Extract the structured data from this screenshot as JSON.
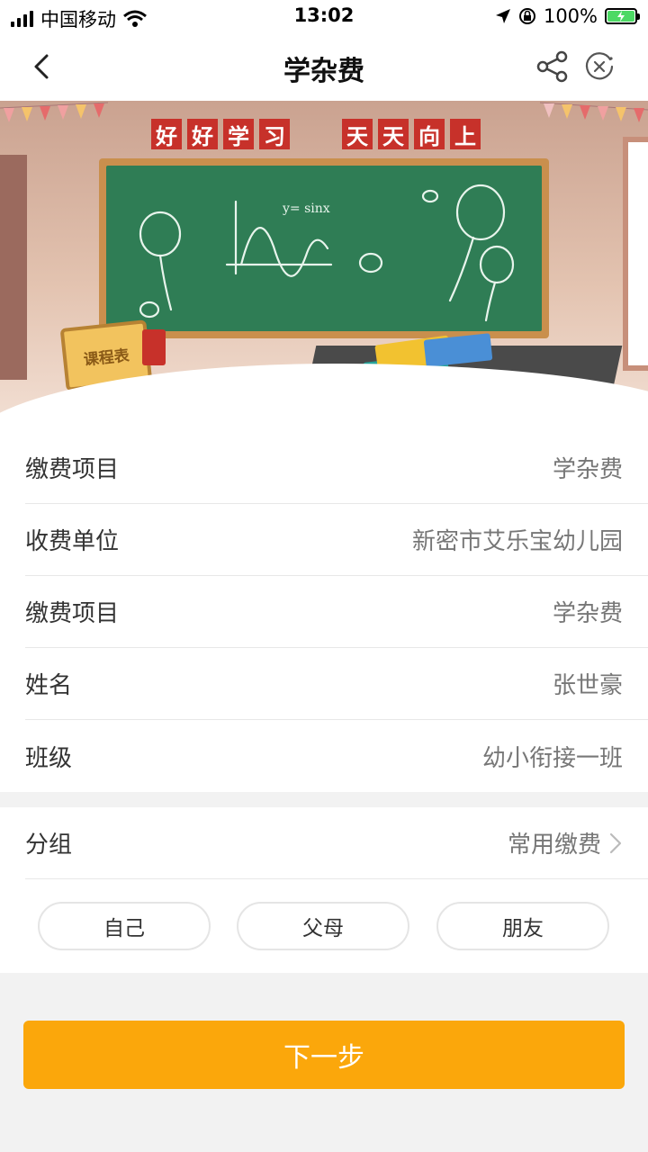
{
  "status_bar": {
    "carrier": "中国移动",
    "time": "13:02",
    "battery": "100%",
    "icons": [
      "signal-icon",
      "wifi-icon",
      "location-icon",
      "orientation-lock-icon",
      "battery-charging-icon"
    ]
  },
  "nav": {
    "title": "学杂费",
    "back_icon": "chevron-left-icon",
    "share_icon": "share-icon",
    "close_icon": "close-circle-icon"
  },
  "banner": {
    "slogan_left": [
      "好",
      "好",
      "学",
      "习"
    ],
    "slogan_right": [
      "天",
      "天",
      "向",
      "上"
    ],
    "board_formula": "y= sinx",
    "timetable_label": "课程表"
  },
  "info_rows": [
    {
      "label": "缴费项目",
      "value": "学杂费"
    },
    {
      "label": "收费单位",
      "value": "新密市艾乐宝幼儿园"
    },
    {
      "label": "缴费项目",
      "value": "学杂费"
    },
    {
      "label": "姓名",
      "value": "张世豪"
    },
    {
      "label": "班级",
      "value": "幼小衔接一班"
    }
  ],
  "group": {
    "label": "分组",
    "value": "常用缴费",
    "chips": [
      "自己",
      "父母",
      "朋友"
    ]
  },
  "next_button": "下一步",
  "colors": {
    "accent": "#fba70b",
    "slogan_red": "#c7312a",
    "chalkboard": "#2f7d55"
  }
}
